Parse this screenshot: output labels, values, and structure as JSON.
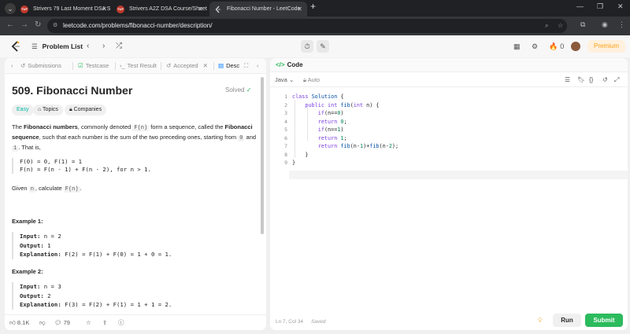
{
  "browser": {
    "tabs": [
      {
        "label": "Strivers 79 Last Moment DSA S"
      },
      {
        "label": "Strivers A2Z DSA Course/Sheet"
      },
      {
        "label": "Fibonacci Number - LeetCode"
      }
    ],
    "url": "leetcode.com/problems/fibonacci-number/description/"
  },
  "nav": {
    "problem_list": "Problem List",
    "streak": "0",
    "premium": "Premium"
  },
  "left": {
    "tabs": {
      "submissions": "Submissions",
      "testcase": "Testcase",
      "test_result": "Test Result",
      "accepted": "Accepted",
      "description": "Desc"
    },
    "title": "509. Fibonacci Number",
    "solved": "Solved",
    "chips": {
      "difficulty": "Easy",
      "topics": "Topics",
      "companies": "Companies"
    },
    "desc": {
      "p1_a": "The ",
      "p1_b": "Fibonacci numbers",
      "p1_c": ", commonly denoted ",
      "p1_code1": "F(n)",
      "p1_d": " form a sequence, called the ",
      "p1_e": "Fibonacci sequence",
      "p1_f": ", such that each number is the sum of the two preceding ones, starting from ",
      "p1_code2": "0",
      "p1_g": " and ",
      "p1_code3": "1",
      "p1_h": ". That is,",
      "formula1": "F(0) = 0, F(1) = 1",
      "formula2": "F(n) = F(n - 1) + F(n - 2), for n > 1.",
      "given_a": "Given ",
      "given_code1": "n",
      "given_b": ", calculate ",
      "given_code2": "F(n)",
      "given_c": "."
    },
    "examples": [
      {
        "title": "Example 1:",
        "input_label": "Input:",
        "input": " n = 2",
        "output_label": "Output:",
        "output": " 1",
        "expl_label": "Explanation:",
        "expl": " F(2) = F(1) + F(0) = 1 + 0 = 1."
      },
      {
        "title": "Example 2:",
        "input_label": "Input:",
        "input": " n = 3",
        "output_label": "Output:",
        "output": " 2",
        "expl_label": "Explanation:",
        "expl": " F(3) = F(2) + F(1) = 1 + 1 = 2."
      }
    ],
    "bottom": {
      "likes": "8.1K",
      "comments": "79"
    }
  },
  "right": {
    "title": "Code",
    "language": "Java",
    "mode": "Auto",
    "lines": [
      "1",
      "2",
      "3",
      "4",
      "5",
      "6",
      "7",
      "8",
      "9"
    ],
    "status": {
      "position": "Ln 7, Col 34",
      "saved": "Saved"
    },
    "run": "Run",
    "submit": "Submit"
  }
}
